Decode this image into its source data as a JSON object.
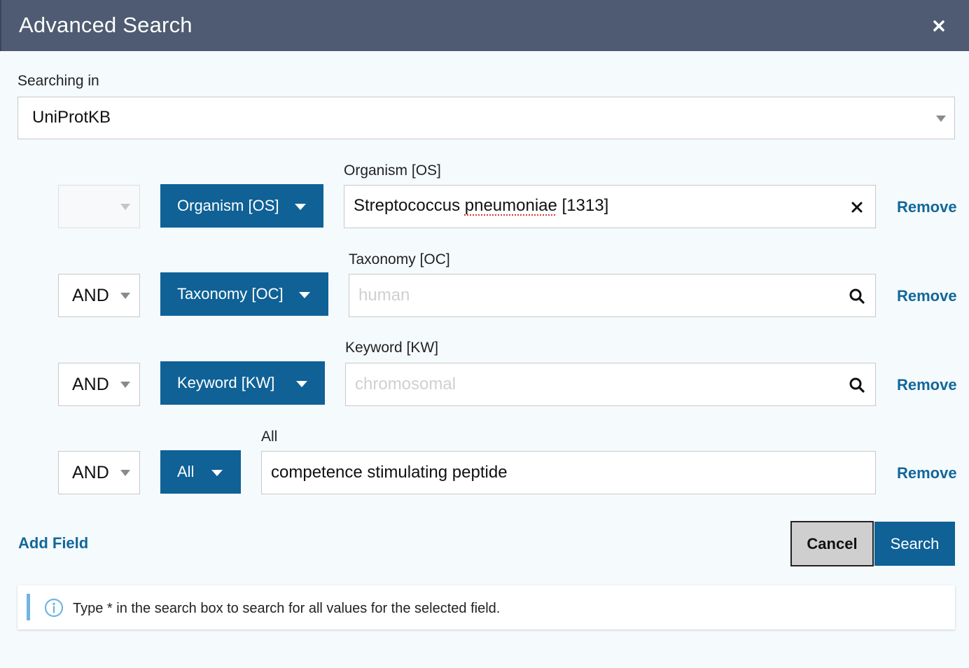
{
  "dialog": {
    "title": "Advanced Search",
    "close_icon": "close-icon"
  },
  "searching_in": {
    "label": "Searching in",
    "selected": "UniProtKB"
  },
  "rows": [
    {
      "operator": "",
      "field_button": "Organism [OS]",
      "field_label": "Organism [OS]",
      "value_prefix": "Streptococcus ",
      "value_misspelled": "pneumoniae",
      "value_suffix": " [1313]",
      "placeholder": "",
      "icon": "clear-icon",
      "remove": "Remove"
    },
    {
      "operator": "AND",
      "field_button": "Taxonomy [OC]",
      "field_label": "Taxonomy [OC]",
      "value": "",
      "placeholder": "human",
      "icon": "search-icon",
      "remove": "Remove"
    },
    {
      "operator": "AND",
      "field_button": "Keyword [KW]",
      "field_label": "Keyword [KW]",
      "value": "",
      "placeholder": "chromosomal",
      "icon": "search-icon",
      "remove": "Remove"
    },
    {
      "operator": "AND",
      "field_button": "All",
      "field_label": "All",
      "value": "competence stimulating peptide",
      "placeholder": "",
      "remove": "Remove"
    }
  ],
  "actions": {
    "add_field": "Add Field",
    "cancel": "Cancel",
    "search": "Search"
  },
  "info": {
    "icon": "info-icon",
    "text": "Type * in the search box to search for all values for the selected field."
  },
  "colors": {
    "header_bg": "#4e5b72",
    "primary": "#0f6196",
    "link": "#12679b",
    "info_bar": "#6fb6e3"
  }
}
